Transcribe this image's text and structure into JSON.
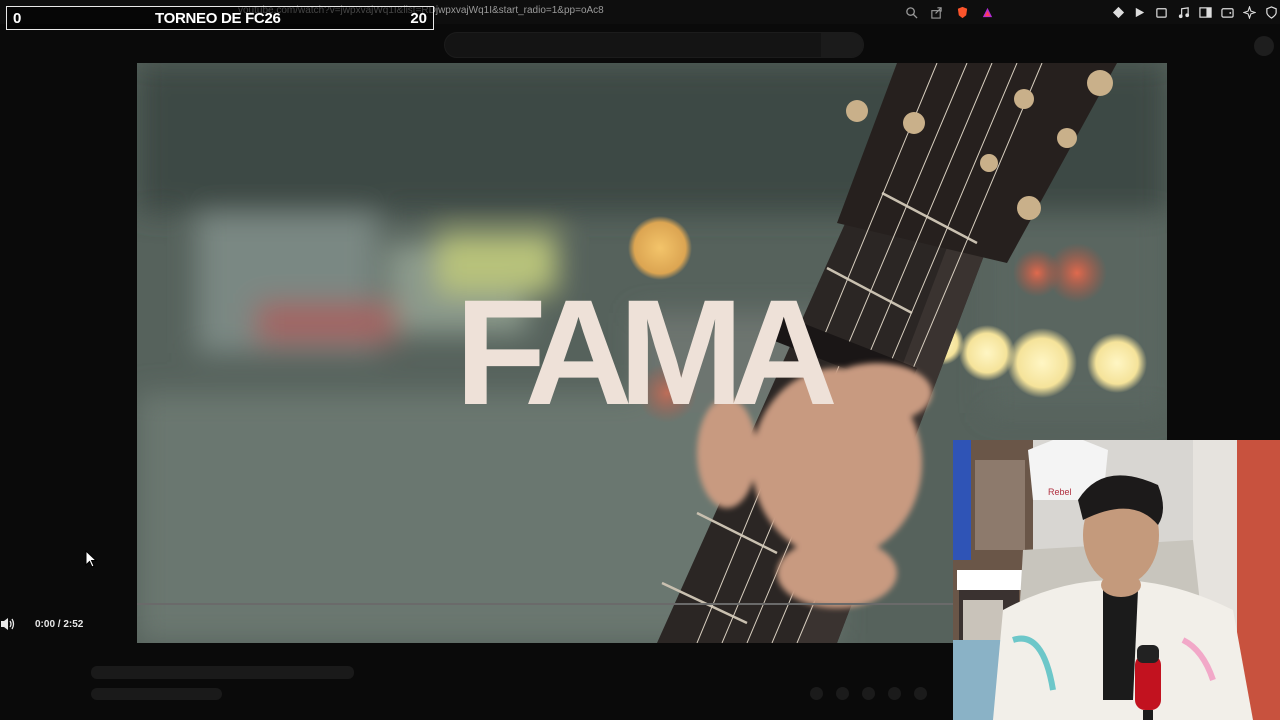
{
  "browser": {
    "url": "youtube.com/watch?v=jwpxvajWq1I&list=RDjwpxvajWq1I&start_radio=1&pp=oAc8",
    "icons": [
      "search-icon",
      "share-icon",
      "brave-shield-icon",
      "rewards-icon",
      "extension-icon",
      "play-icon",
      "puzzle-icon",
      "music-icon",
      "sidebar-icon",
      "wallet-icon",
      "leo-icon",
      "vpn-icon"
    ]
  },
  "scoreboard": {
    "left_score": "0",
    "title": "TORNEO DE FC26",
    "right_score": "20"
  },
  "video": {
    "title_overlay": "FAMA",
    "time": "0:00 / 2:52",
    "progress": 0.0
  },
  "colors": {
    "background": "#0a0a0a",
    "overlay_text": "#eee1d8",
    "brave": "#fb542b"
  }
}
